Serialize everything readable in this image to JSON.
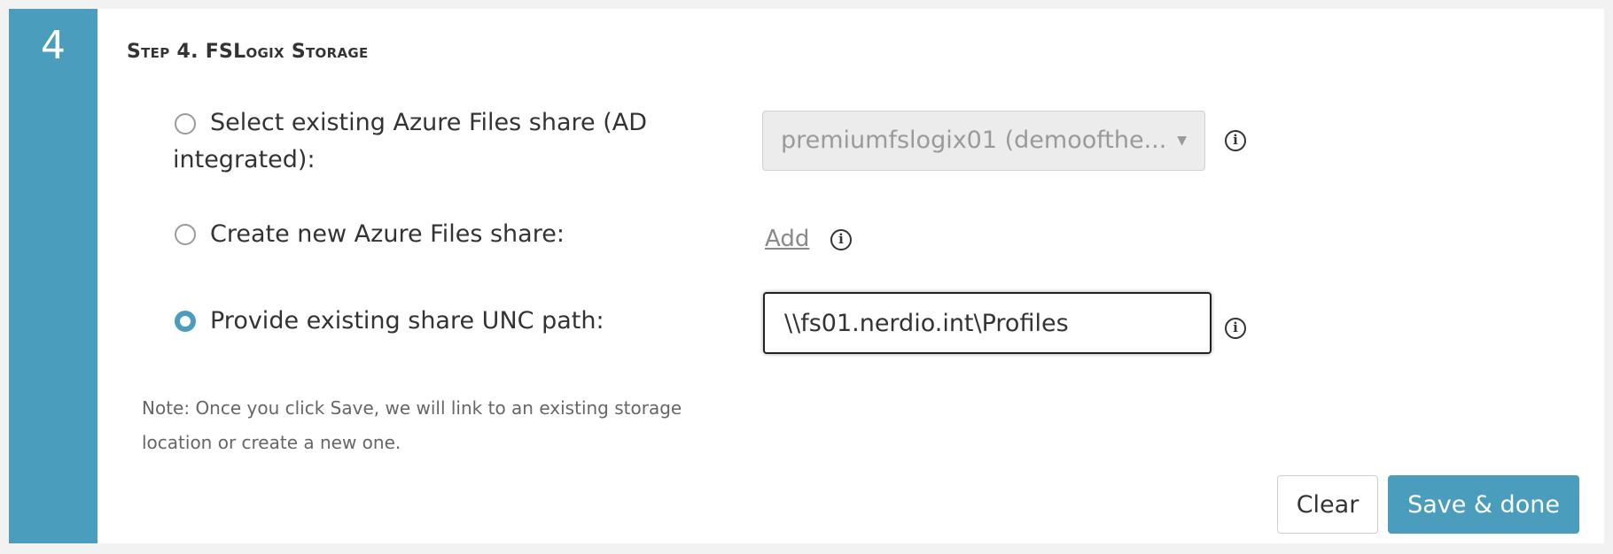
{
  "step": {
    "number": "4",
    "title": "Step 4. FSLogix Storage"
  },
  "options": {
    "existing_azure_files": {
      "label": "Select existing Azure Files share (AD integrated):",
      "selected": false,
      "select_value": "premiumfslogix01 (demoofthe..."
    },
    "new_azure_files": {
      "label": "Create new Azure Files share:",
      "selected": false,
      "add_label": "Add"
    },
    "unc_path": {
      "label": "Provide existing share UNC path:",
      "selected": true,
      "value": "\\\\fs01.nerdio.int\\Profiles"
    }
  },
  "note": "Note: Once you click Save, we will link to an existing storage location or create a new one.",
  "buttons": {
    "clear": "Clear",
    "save": "Save & done"
  },
  "icons": {
    "info": "info-icon",
    "dropdown": "chevron-down-icon"
  },
  "colors": {
    "accent": "#4a9dbd",
    "text": "#333333",
    "muted": "#8a8a8a"
  }
}
